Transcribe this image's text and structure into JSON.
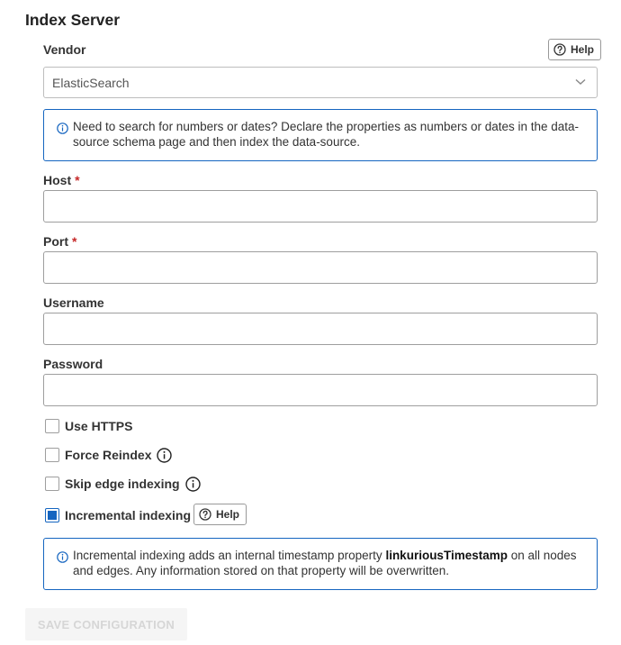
{
  "section": {
    "title": "Index Server"
  },
  "vendor": {
    "label": "Vendor",
    "help_label": "Help",
    "selected_value": "ElasticSearch"
  },
  "info_numbers": {
    "text": "Need to search for numbers or dates? Declare the properties as numbers or dates in the data-source schema page and then index the data-source."
  },
  "fields": {
    "host": {
      "label": "Host",
      "required_mark": "*",
      "value": ""
    },
    "port": {
      "label": "Port",
      "required_mark": "*",
      "value": ""
    },
    "username": {
      "label": "Username",
      "value": ""
    },
    "password": {
      "label": "Password",
      "value": ""
    }
  },
  "checkboxes": {
    "use_https": {
      "label": "Use HTTPS",
      "checked": false
    },
    "force_reindex": {
      "label": "Force Reindex",
      "checked": false
    },
    "skip_edge_indexing": {
      "label": "Skip edge indexing",
      "checked": false
    },
    "incremental_indexing": {
      "label": "Incremental indexing",
      "checked": true,
      "help_label": "Help"
    }
  },
  "info_incremental": {
    "text_before": "Incremental indexing adds an internal timestamp property ",
    "bold_term": "linkuriousTimestamp",
    "text_after": " on all nodes and edges. Any information stored on that property will be overwritten."
  },
  "actions": {
    "save_label": "SAVE CONFIGURATION"
  },
  "colors": {
    "accent": "#1565c0",
    "required": "#c62828",
    "disabled_text": "#d6d6d6"
  }
}
